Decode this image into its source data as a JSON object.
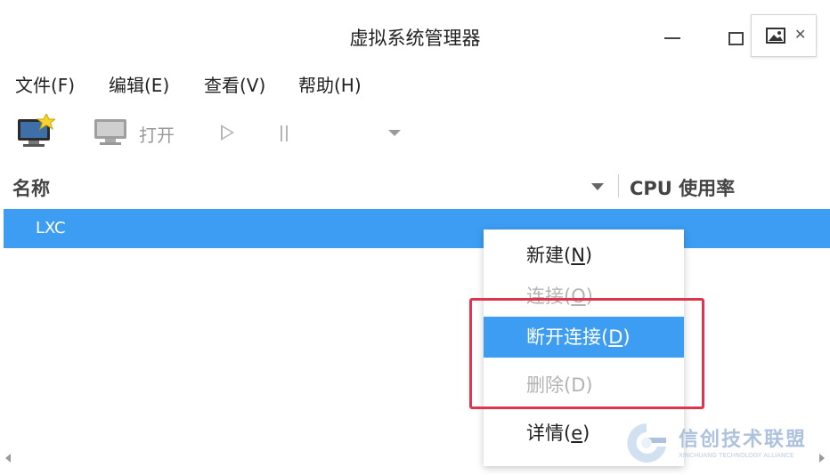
{
  "window": {
    "title": "虚拟系统管理器"
  },
  "menubar": [
    "文件(F)",
    "编辑(E)",
    "查看(V)",
    "帮助(H)"
  ],
  "toolbar": {
    "open_label": "打开"
  },
  "columns": {
    "name": "名称",
    "cpu": "CPU  使用率"
  },
  "rows": [
    {
      "name": "LXC"
    }
  ],
  "context_menu": {
    "items": [
      {
        "label": "新建(",
        "mnemonic": "N",
        "suffix": ")",
        "state": "enabled"
      },
      {
        "label": "连接(",
        "mnemonic": "O",
        "suffix": ")",
        "state": "disabled"
      },
      {
        "label": "断开连接(",
        "mnemonic": "D",
        "suffix": ")",
        "state": "active"
      },
      {
        "label": "删除(",
        "mnemonic": "D",
        "suffix": ")",
        "state": "disabled"
      },
      {
        "label": "详情(",
        "mnemonic": "e",
        "suffix": ")",
        "state": "enabled"
      }
    ]
  },
  "watermark": {
    "title": "信创技术联盟",
    "subtitle": "XINCHUANG TECHNOLOGY ALLIANCE"
  },
  "colors": {
    "selection": "#3d9df3",
    "highlight_box": "#e0334d",
    "watermark": "#9fb8d8"
  },
  "icons": [
    "new-connection-icon",
    "monitor-icon",
    "play-icon",
    "pause-icon",
    "dropdown-arrow-icon",
    "image-icon",
    "close-icon",
    "sort-arrow-icon"
  ]
}
